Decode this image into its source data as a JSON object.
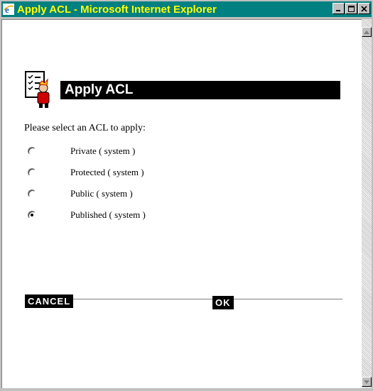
{
  "window": {
    "title": "Apply ACL - Microsoft Internet Explorer"
  },
  "page": {
    "heading": "Apply ACL",
    "prompt": "Please select an ACL to apply:",
    "acl_options": [
      {
        "label": "Private ( system )",
        "selected": false
      },
      {
        "label": "Protected ( system )",
        "selected": false
      },
      {
        "label": "Public ( system )",
        "selected": false
      },
      {
        "label": "Published ( system )",
        "selected": true
      }
    ],
    "cancel_label": "CANCEL",
    "ok_label": "OK"
  },
  "icons": {
    "title": "ie-logo-icon",
    "header": "acl-checklist-person-icon"
  },
  "colors": {
    "titlebar_bg": "#008080",
    "titlebar_text": "#ffff00",
    "header_bg": "#000000",
    "header_text": "#ffffff"
  }
}
